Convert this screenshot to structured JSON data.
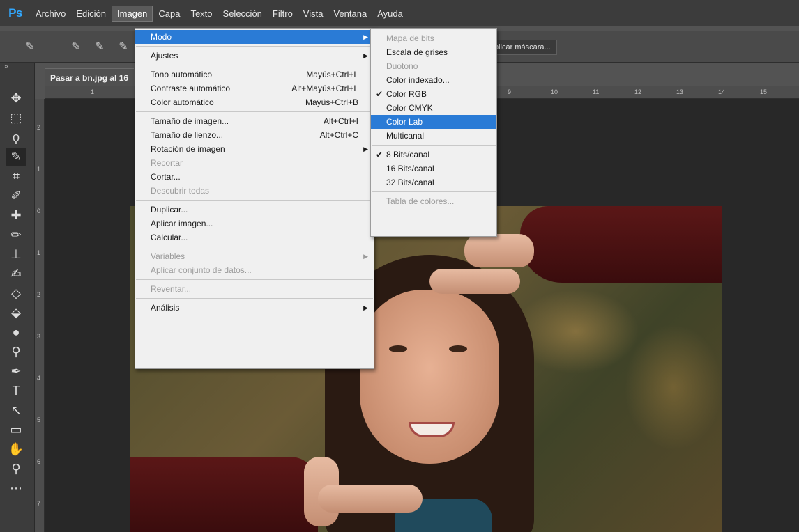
{
  "app": {
    "logo": "Ps"
  },
  "menubar": {
    "items": [
      "Archivo",
      "Edición",
      "Imagen",
      "Capa",
      "Texto",
      "Selección",
      "Filtro",
      "Vista",
      "Ventana",
      "Ayuda"
    ]
  },
  "options": {
    "mask_button": "plicar máscara..."
  },
  "document": {
    "tab_title": "Pasar a bn.jpg al 16"
  },
  "rulers": {
    "top": [
      "1",
      "9",
      "10",
      "11",
      "12",
      "13",
      "14",
      "15"
    ],
    "left": [
      "2",
      "1",
      "0",
      "1",
      "2",
      "3",
      "4",
      "5",
      "6",
      "7"
    ]
  },
  "imagen_menu": {
    "modo": "Modo",
    "ajustes": "Ajustes",
    "tono_auto": "Tono automático",
    "tono_auto_sc": "Mayús+Ctrl+L",
    "contraste_auto": "Contraste automático",
    "contraste_auto_sc": "Alt+Mayús+Ctrl+L",
    "color_auto": "Color automático",
    "color_auto_sc": "Mayús+Ctrl+B",
    "tam_imagen": "Tamaño de imagen...",
    "tam_imagen_sc": "Alt+Ctrl+I",
    "tam_lienzo": "Tamaño de lienzo...",
    "tam_lienzo_sc": "Alt+Ctrl+C",
    "rotacion": "Rotación de imagen",
    "recortar": "Recortar",
    "cortar": "Cortar...",
    "descubrir": "Descubrir todas",
    "duplicar": "Duplicar...",
    "aplicar_imagen": "Aplicar imagen...",
    "calcular": "Calcular...",
    "variables": "Variables",
    "aplicar_conjunto": "Aplicar conjunto de datos...",
    "reventar": "Reventar...",
    "analisis": "Análisis"
  },
  "modo_menu": {
    "mapa_bits": "Mapa de bits",
    "escala_grises": "Escala de grises",
    "duotono": "Duotono",
    "color_indexado": "Color indexado...",
    "color_rgb": "Color RGB",
    "color_cmyk": "Color CMYK",
    "color_lab": "Color Lab",
    "multicanal": "Multicanal",
    "bits8": "8 Bits/canal",
    "bits16": "16 Bits/canal",
    "bits32": "32 Bits/canal",
    "tabla_colores": "Tabla de colores..."
  },
  "colors": {
    "highlight": "#2a7bd6",
    "ps_blue": "#31a8ff",
    "menubar": "#3c3c3c",
    "menu_bg": "#f0f0f0"
  }
}
